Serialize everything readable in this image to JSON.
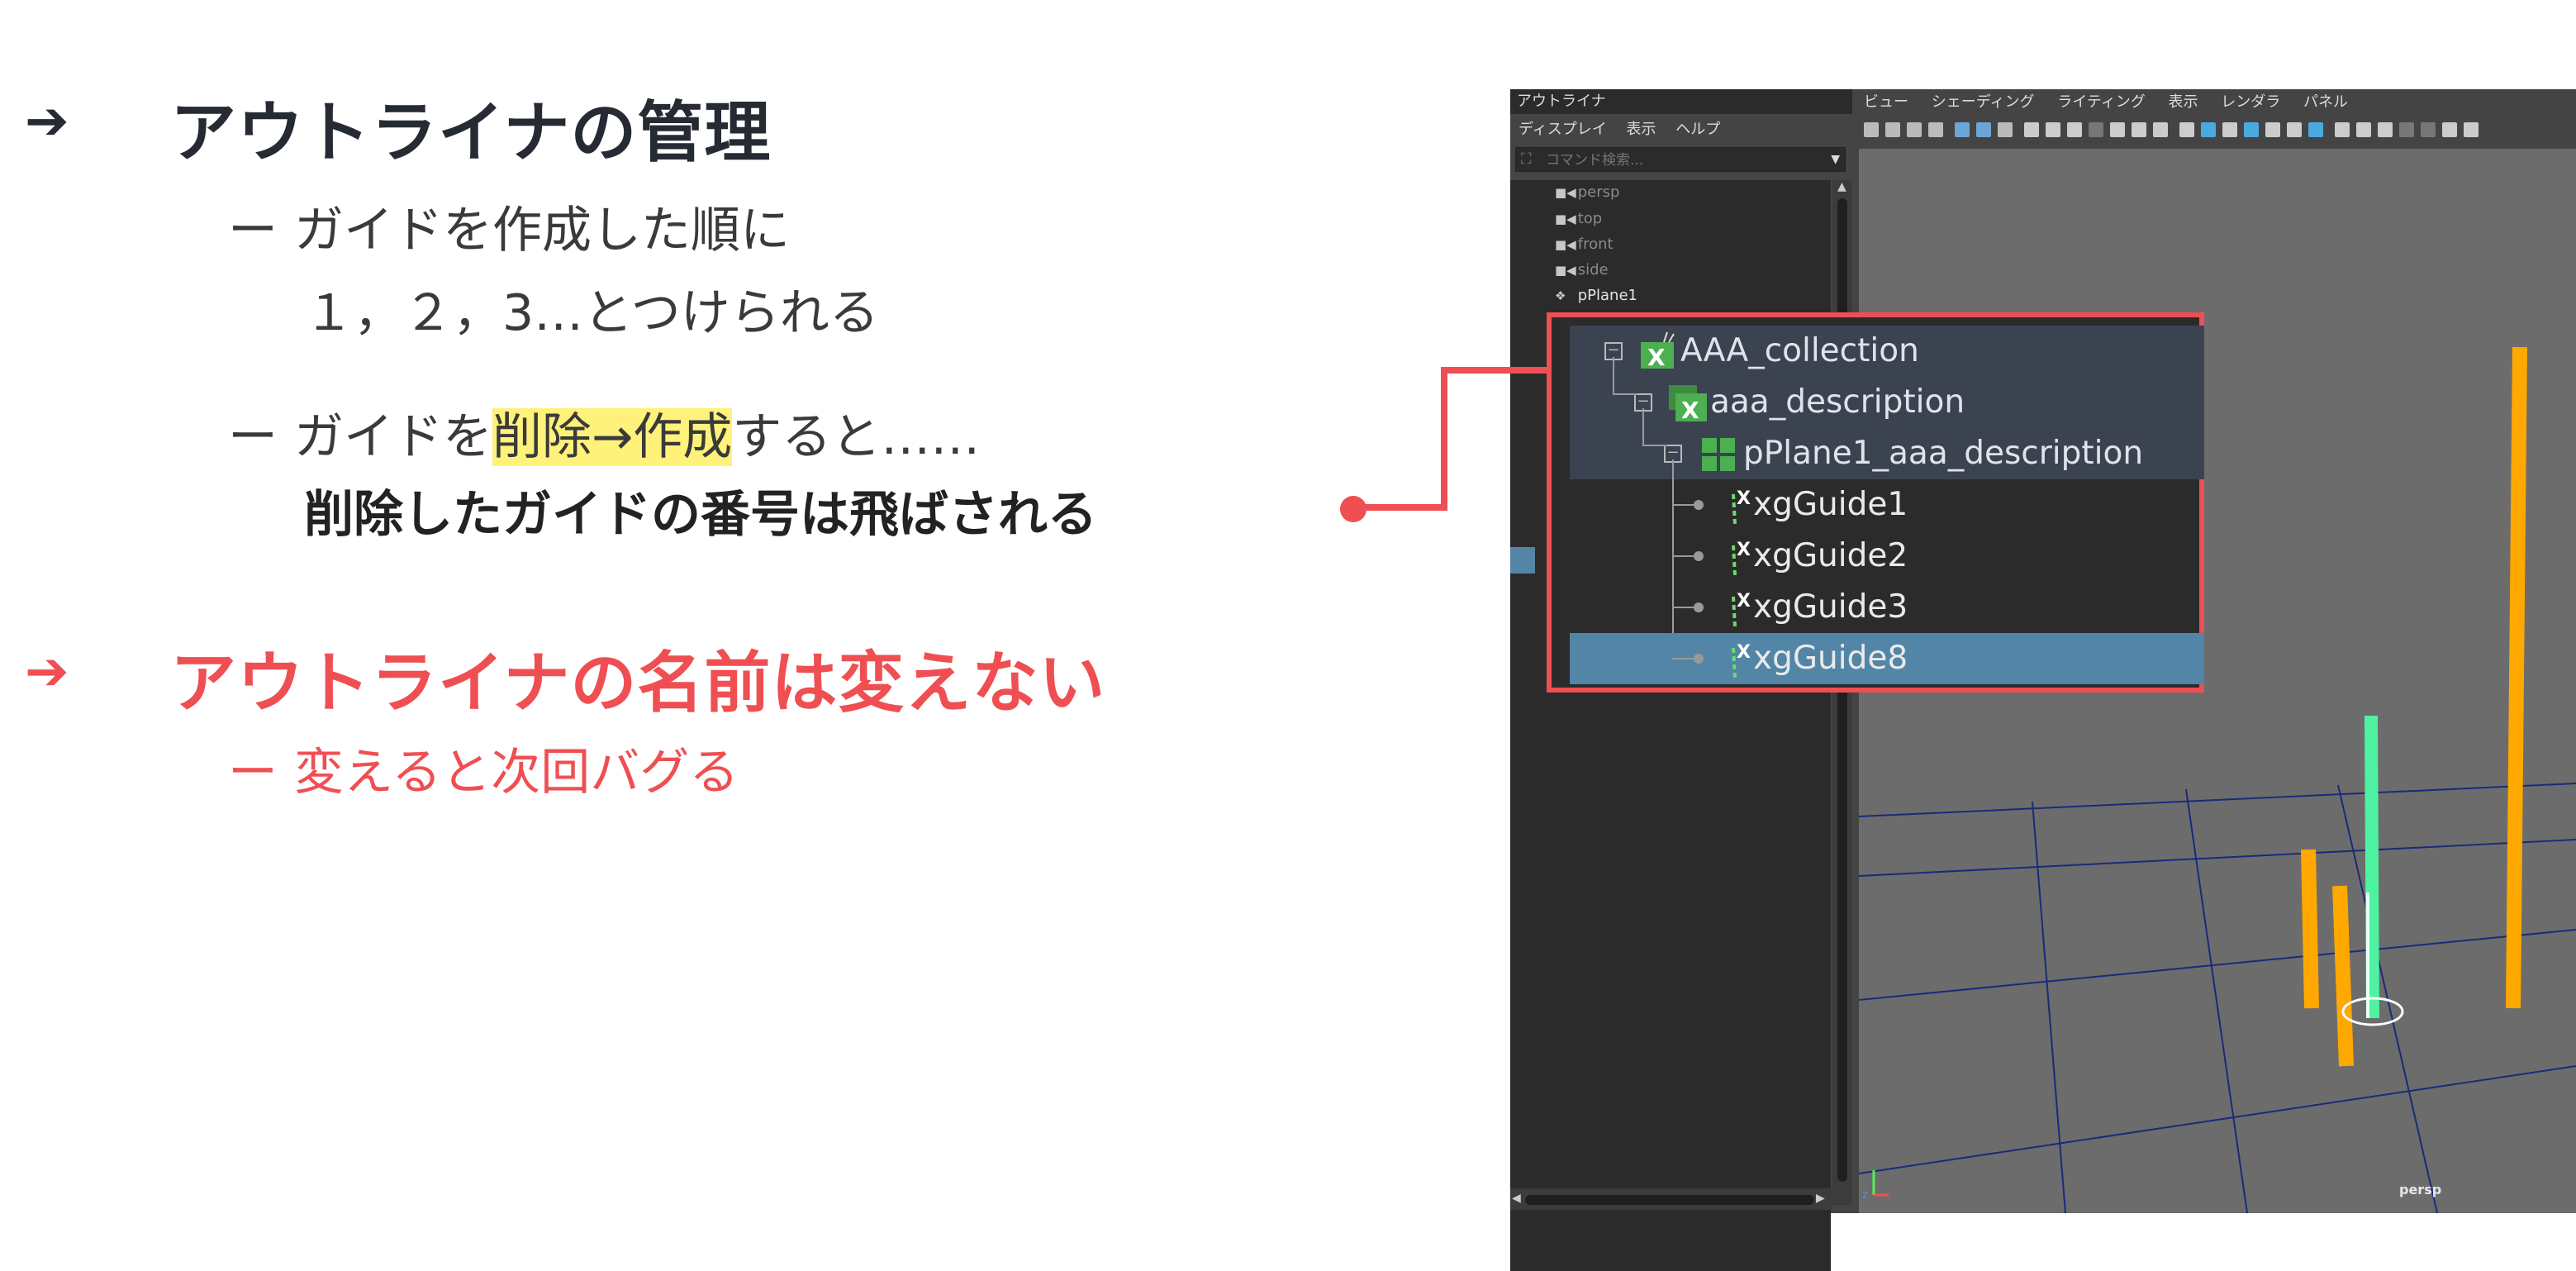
{
  "slide": {
    "bullet1": {
      "arrow": "➔",
      "title": "アウトライナの管理"
    },
    "sub1": {
      "dash": "ー",
      "line1": "ガイドを作成した順に",
      "line2": "１，２，3…とつけられる"
    },
    "sub2": {
      "dash": "ー",
      "before": "ガイドを",
      "highlight": "削除→作成",
      "after": "すると……",
      "line2": "削除したガイドの番号は飛ばされる"
    },
    "bullet2": {
      "arrow": "➔",
      "title": "アウトライナの名前は変えない"
    },
    "sub3": {
      "dash": "ー",
      "text": "変えると次回バグる"
    }
  },
  "outliner": {
    "title": "アウトライナ",
    "menu": [
      "ディスプレイ",
      "表示",
      "ヘルプ"
    ],
    "search_placeholder": "コマンド検索...",
    "items": [
      {
        "label": "persp",
        "icon": "camera-icon"
      },
      {
        "label": "top",
        "icon": "camera-icon"
      },
      {
        "label": "front",
        "icon": "camera-icon"
      },
      {
        "label": "side",
        "icon": "camera-icon"
      },
      {
        "label": "pPlane1",
        "icon": "transform-icon"
      }
    ]
  },
  "viewport": {
    "menu": [
      "ビュー",
      "シェーディング",
      "ライティング",
      "表示",
      "レンダラ",
      "パネル"
    ],
    "camera_label": "persp"
  },
  "zoom": {
    "rows": [
      {
        "label": "AAA_collection",
        "icon": "xgen-collection-icon"
      },
      {
        "label": "aaa_description",
        "icon": "xgen-description-icon"
      },
      {
        "label": "pPlane1_aaa_description",
        "icon": "patch-icon"
      },
      {
        "label": "xgGuide1",
        "icon": "xgen-guide-icon"
      },
      {
        "label": "xgGuide2",
        "icon": "xgen-guide-icon"
      },
      {
        "label": "xgGuide3",
        "icon": "xgen-guide-icon"
      },
      {
        "label": "xgGuide8",
        "icon": "xgen-guide-icon"
      }
    ]
  },
  "colors": {
    "accent_red": "#ef4f52",
    "highlight_yellow": "#fff27a",
    "selection_blue": "#5285a6",
    "guide_orange": "#ffa800",
    "guide_green": "#4ff2a0"
  }
}
